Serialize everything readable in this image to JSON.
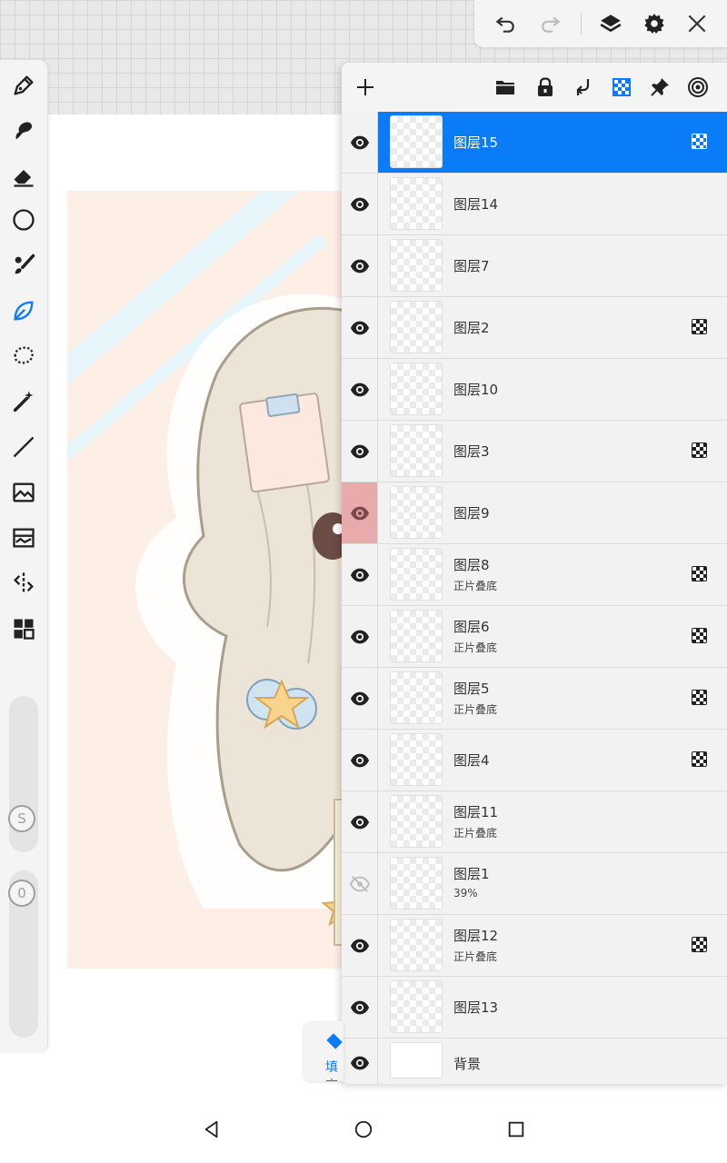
{
  "colors": {
    "accent": "#0a7cf7",
    "hidden_layer_marker": "#e8aaaa",
    "panel_bg": "#f2f2f2"
  },
  "left_toolbar": {
    "tools": [
      {
        "icon": "pen-icon",
        "active": false
      },
      {
        "icon": "smudge-icon",
        "active": false
      },
      {
        "icon": "eraser-icon",
        "active": false
      },
      {
        "icon": "shape-circle-icon",
        "active": false
      },
      {
        "icon": "brush-icon",
        "active": false
      },
      {
        "icon": "leaf-icon",
        "active": true
      },
      {
        "icon": "lasso-icon",
        "active": false
      },
      {
        "icon": "magic-wand-icon",
        "active": false
      },
      {
        "icon": "line-icon",
        "active": false
      },
      {
        "icon": "image-insert-icon",
        "active": false
      },
      {
        "icon": "filter-icon",
        "active": false
      },
      {
        "icon": "symmetry-icon",
        "active": false
      },
      {
        "icon": "material-grid-icon",
        "active": false
      }
    ],
    "size_slider_label": "S",
    "opacity_slider_label": "0"
  },
  "top_actions": {
    "icons": [
      "undo-icon",
      "redo-icon",
      "layers-icon",
      "settings-icon",
      "close-icon"
    ]
  },
  "layer_panel_toolbar": {
    "icons": [
      "add-layer-icon",
      "folder-icon",
      "lock-icon",
      "merge-down-icon",
      "alpha-lock-icon",
      "pin-icon",
      "target-icon"
    ]
  },
  "layers": [
    {
      "name": "图层15",
      "sub": "",
      "alpha_locked": true,
      "selected": true,
      "visible": true,
      "marked": false
    },
    {
      "name": "图层14",
      "sub": "",
      "alpha_locked": false,
      "selected": false,
      "visible": true,
      "marked": false
    },
    {
      "name": "图层7",
      "sub": "",
      "alpha_locked": false,
      "selected": false,
      "visible": true,
      "marked": false
    },
    {
      "name": "图层2",
      "sub": "",
      "alpha_locked": true,
      "selected": false,
      "visible": true,
      "marked": false
    },
    {
      "name": "图层10",
      "sub": "",
      "alpha_locked": false,
      "selected": false,
      "visible": true,
      "marked": false
    },
    {
      "name": "图层3",
      "sub": "",
      "alpha_locked": true,
      "selected": false,
      "visible": true,
      "marked": false
    },
    {
      "name": "图层9",
      "sub": "",
      "alpha_locked": false,
      "selected": false,
      "visible": true,
      "marked": true
    },
    {
      "name": "图层8",
      "sub": "正片叠底",
      "alpha_locked": true,
      "selected": false,
      "visible": true,
      "marked": false
    },
    {
      "name": "图层6",
      "sub": "正片叠底",
      "alpha_locked": true,
      "selected": false,
      "visible": true,
      "marked": false
    },
    {
      "name": "图层5",
      "sub": "正片叠底",
      "alpha_locked": true,
      "selected": false,
      "visible": true,
      "marked": false
    },
    {
      "name": "图层4",
      "sub": "",
      "alpha_locked": true,
      "selected": false,
      "visible": true,
      "marked": false
    },
    {
      "name": "图层11",
      "sub": "正片叠底",
      "alpha_locked": false,
      "selected": false,
      "visible": true,
      "marked": false
    },
    {
      "name": "图层1",
      "sub": "39%",
      "alpha_locked": false,
      "selected": false,
      "visible": false,
      "marked": false
    },
    {
      "name": "图层12",
      "sub": "正片叠底",
      "alpha_locked": true,
      "selected": false,
      "visible": true,
      "marked": false
    },
    {
      "name": "图层13",
      "sub": "",
      "alpha_locked": false,
      "selected": false,
      "visible": true,
      "marked": false
    },
    {
      "name": "背景",
      "sub": "",
      "alpha_locked": false,
      "selected": false,
      "visible": true,
      "marked": false,
      "plain": true
    }
  ],
  "fill_button": {
    "label": "填充"
  },
  "nav_bar": {
    "icons": [
      "back-icon",
      "home-icon",
      "recents-icon"
    ]
  }
}
